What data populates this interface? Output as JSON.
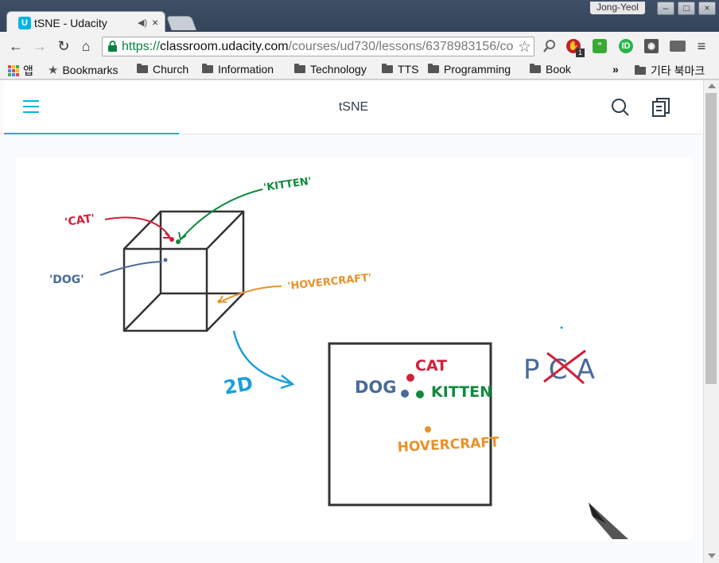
{
  "window": {
    "user": "Jong-Yeol",
    "controls": [
      "–",
      "□",
      "×"
    ]
  },
  "tab": {
    "title": "tSNE - Udacity",
    "favicon_letter": "U",
    "audio_icon": "◀)",
    "close": "×"
  },
  "address_bar": {
    "scheme": "https://",
    "host": "classroom.udacity.com",
    "path": "/courses/ud730/lessons/6378983156/co"
  },
  "bookmarks": {
    "apps_label": "앱",
    "items": [
      "Bookmarks",
      "Church",
      "Information",
      "Technology",
      "TTS",
      "Programming",
      "Book"
    ],
    "overflow": "»",
    "other": "기타 북마크"
  },
  "extensions": {
    "badge_count": "1"
  },
  "page": {
    "title": "tSNE"
  },
  "drawing": {
    "labels_3d": {
      "cat": "'CAT'",
      "kitten": "'KITTEN'",
      "dog": "'DOG'",
      "hovercraft": "'HOVERCRAFT'"
    },
    "arrow_label": "2D",
    "labels_2d": {
      "cat": "CAT",
      "dog": "DOG",
      "kitten": "KITTEN",
      "hovercraft": "HOVERCRAFT"
    },
    "method_crossed": "PCA",
    "colors": {
      "cat": "#d0203a",
      "kitten": "#108a3e",
      "dog": "#4a6a9a",
      "hovercraft": "#e8922a",
      "arrow": "#1aa0d8",
      "ink": "#333333"
    }
  }
}
